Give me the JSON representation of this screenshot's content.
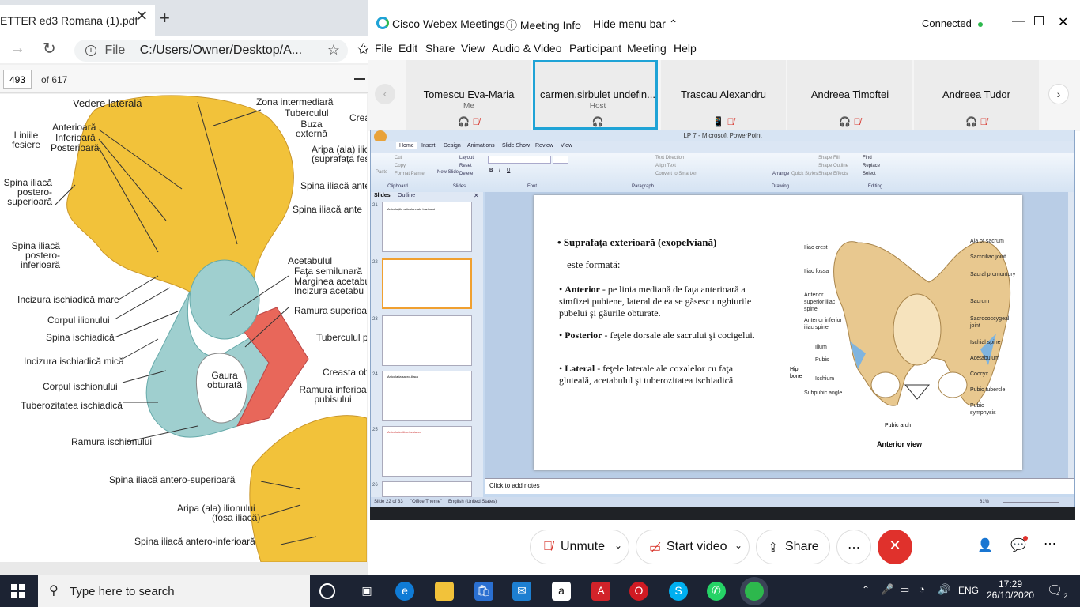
{
  "pdf_viewer": {
    "tab_title": "ETTER ed3 Romana (1).pdf",
    "address_prefix": "File",
    "address": "C:/Users/Owner/Desktop/A...",
    "page_current": "493",
    "page_total": "of 617",
    "labels": {
      "vedere_laterala": "Vedere laterală",
      "zona_intermediara": "Zona intermediară",
      "tuberculul": "Tuberculul",
      "buza_externa": "Buza externă",
      "creasta_partial": "Crea",
      "liniile_fesiere": "Liniile fesiere",
      "anterioara": "Anterioară",
      "inferioara": "Inferioară",
      "posterioara": "Posterioară",
      "aripa_ala": "Aripa (ala) ilic",
      "suprafata_fes": "(suprafaţa fes",
      "spina_iliaca_postero_superioara": "Spina iliacă postero-superioară",
      "spina_iliaca_ante_1": "Spina iliacă ante",
      "spina_iliaca_ante_2": "Spina iliacă ante",
      "spina_iliaca_postero_inferioara": "Spina iliacă postero-inferioară",
      "acetabulul": "Acetabulul",
      "fata_semilunara": "Faţa semilunară",
      "marginea_acetabu": "Marginea acetabu",
      "incizura_acetabu": "Incizura acetabu",
      "incizura_ischiadica_mare": "Incizura ischiadică mare",
      "ramura_superioar": "Ramura superioar",
      "corpul_ilionului": "Corpul ilionului",
      "spina_ischiadica": "Spina ischiadică",
      "tuberculul_p": "Tuberculul p",
      "incizura_ischiadica_mica": "Incizura ischiadică mică",
      "creasta_ob": "Creasta ob",
      "gaura_obturata": "Gaura obturată",
      "corpul_ischionului": "Corpul ischionului",
      "ramura_inferioara_pubisului": "Ramura inferioa pubisului",
      "tuberozitatea_ischiadica": "Tuberozitatea ischiadică",
      "ramura_ischionului": "Ramura ischionului",
      "spina_iliaca_antero_superioara": "Spina iliacă antero-superioară",
      "aripa_ala_ilionului": "Aripa (ala) ilionului",
      "fosa_iliaca": "(fosa iliacă)",
      "spina_iliaca_antero_inferioara": "Spina iliacă antero-inferioară"
    }
  },
  "webex": {
    "app_name": "Cisco Webex Meetings",
    "meeting_info": "Meeting Info",
    "hide_menu_bar": "Hide menu bar",
    "status": "Connected",
    "menu": [
      "File",
      "Edit",
      "Share",
      "View",
      "Audio & Video",
      "Participant",
      "Meeting",
      "Help"
    ],
    "participants": [
      {
        "name": "Tomescu Eva-Maria",
        "role": "Me"
      },
      {
        "name": "carmen.sirbulet undefin...",
        "role": "Host"
      },
      {
        "name": "Trascau Alexandru",
        "role": ""
      },
      {
        "name": "Andreea Timoftei",
        "role": ""
      },
      {
        "name": "Andreea Tudor",
        "role": ""
      }
    ],
    "controls": {
      "unmute": "Unmute",
      "start_video": "Start video",
      "share": "Share",
      "more": "⋯"
    },
    "colors": {
      "accent": "#1fa3d6",
      "end": "#e0312c",
      "connected": "#2db84d",
      "muted": "#d8342a"
    }
  },
  "powerpoint": {
    "title": "LP 7 - Microsoft PowerPoint",
    "tabs": [
      "Home",
      "Insert",
      "Design",
      "Animations",
      "Slide Show",
      "Review",
      "View"
    ],
    "groups": [
      "Clipboard",
      "Slides",
      "Font",
      "Paragraph",
      "Drawing",
      "Editing"
    ],
    "clipboard": [
      "Cut",
      "Copy",
      "Format Painter",
      "Paste"
    ],
    "slides_group": [
      "Layout",
      "Reset",
      "Delete",
      "New Slide"
    ],
    "paragraph_items": [
      "Text Direction",
      "Align Text",
      "Convert to SmartArt"
    ],
    "drawing_items": [
      "Shape Fill",
      "Shape Outline",
      "Shape Effects",
      "Arrange",
      "Quick Styles"
    ],
    "editing_items": [
      "Find",
      "Replace",
      "Select"
    ],
    "pane_tabs": [
      "Slides",
      "Outline"
    ],
    "thumb_numbers": [
      "21",
      "22",
      "23",
      "24",
      "25",
      "26"
    ],
    "thumb_captions": {
      "t21": "Articulațiile articulare ale bazinului",
      "t24_line1": "Articulatia sacro-iliaca",
      "t25": "Articulatia tibio-tarsiana"
    },
    "notes_placeholder": "Click to add notes",
    "status": {
      "slide": "Slide 22 of 33",
      "theme": "\"Office Theme\"",
      "lang": "English (United States)",
      "zoom": "81%"
    },
    "slide": {
      "heading": "Suprafaţa exterioară (exopelviană)",
      "subheading": "este formată:",
      "bullets": [
        {
          "term": "Anterior",
          "text": " - pe linia mediană de faţa anterioară a simfizei pubiene, lateral de ea se găsesc unghiurile pubelui şi găurile obturate."
        },
        {
          "term": "Posterior",
          "text": " - feţele dorsale ale sacrului şi cocigelui."
        },
        {
          "term": "Lateral",
          "text": " - feţele laterale ale coxalelor cu faţa gluteală, acetabulul şi tuberozitatea ischiadică"
        }
      ],
      "figure_caption": "Anterior view",
      "labels_left": [
        "Iliac crest",
        "Iliac fossa",
        "Anterior superior iliac spine",
        "Anterior inferior iliac spine",
        "Ilium",
        "Pubis",
        "Ischium",
        "Hip bone",
        "Subpubic angle"
      ],
      "labels_right": [
        "Ala of sacrum",
        "Sacroiliac joint",
        "Sacral promontory",
        "Sacrum",
        "Sacrococcygeal joint",
        "Ischial spine",
        "Acetabulum",
        "Coccyx",
        "Pubic tubercle",
        "Pubic symphysis"
      ],
      "label_bottom": "Pubic arch"
    }
  },
  "taskbar": {
    "search_placeholder": "Type here to search",
    "language": "ENG",
    "time": "17:29",
    "date": "26/10/2020",
    "notifications": "2"
  }
}
